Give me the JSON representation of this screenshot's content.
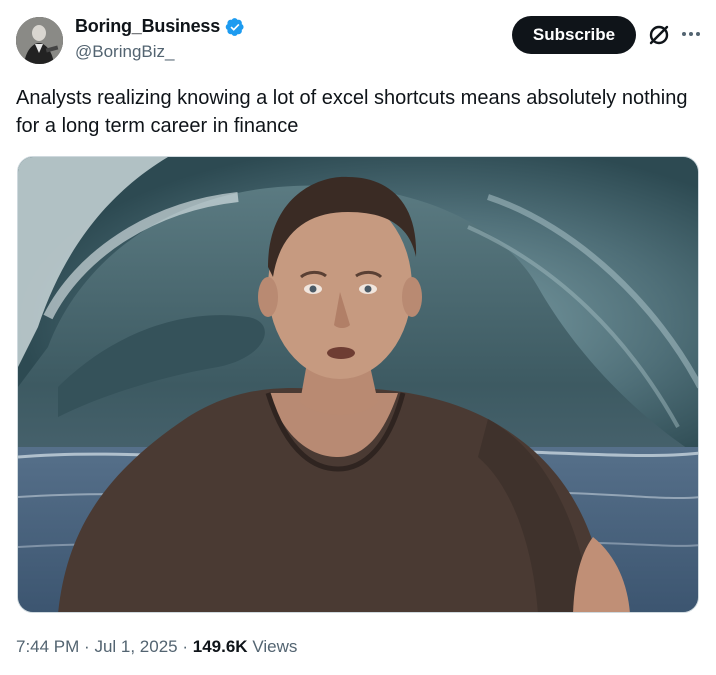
{
  "author": {
    "display_name": "Boring_Business",
    "handle": "@BoringBiz_"
  },
  "actions": {
    "subscribe_label": "Subscribe"
  },
  "tweet": {
    "text": "Analysts realizing knowing a lot of excel shortcuts means absolutely nothing for a long term career in finance",
    "time": "7:44 PM",
    "date": "Jul 1, 2025",
    "views_count": "149.6K",
    "views_label": "Views"
  },
  "icons": {
    "verified": "verified-badge-icon",
    "grok": "grok-icon",
    "more": "more-options-icon"
  },
  "colors": {
    "verified_blue": "#1d9bf0",
    "subscribe_bg": "#0f1419",
    "secondary_text": "#536471"
  }
}
